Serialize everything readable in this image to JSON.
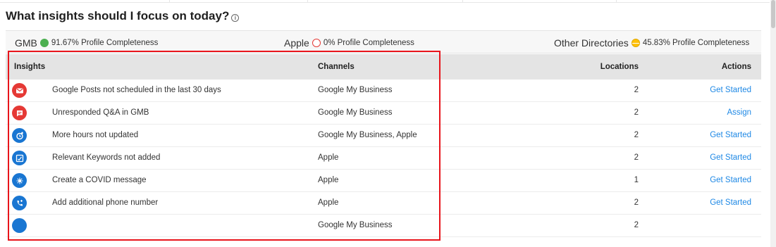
{
  "heading": {
    "title": "What insights should I focus on today?",
    "info_icon": "i"
  },
  "completeness": [
    {
      "name": "GMB",
      "status_color": "#4caf50",
      "text": "91.67% Profile Completeness"
    },
    {
      "name": "Apple",
      "status_color": "#e53935",
      "text": "0% Profile Completeness"
    },
    {
      "name": "Other Directories",
      "status_color": "#ffc107",
      "text": "45.83% Profile Completeness"
    }
  ],
  "table": {
    "headers": {
      "insights": "Insights",
      "channels": "Channels",
      "locations": "Locations",
      "actions": "Actions"
    },
    "rows": [
      {
        "icon": "mail-icon",
        "icon_color": "#e53935",
        "insight": "Google Posts not scheduled in the last 30 days",
        "channels": "Google My Business",
        "locations": "2",
        "action": "Get Started"
      },
      {
        "icon": "chat-icon",
        "icon_color": "#e53935",
        "insight": "Unresponded Q&A in GMB",
        "channels": "Google My Business",
        "locations": "2",
        "action": "Assign"
      },
      {
        "icon": "clock-add-icon",
        "icon_color": "#1976d2",
        "insight": "More hours not updated",
        "channels": "Google My Business, Apple",
        "locations": "2",
        "action": "Get Started"
      },
      {
        "icon": "keyword-icon",
        "icon_color": "#1976d2",
        "insight": "Relevant Keywords not added",
        "channels": "Apple",
        "locations": "2",
        "action": "Get Started"
      },
      {
        "icon": "virus-icon",
        "icon_color": "#1976d2",
        "insight": "Create a COVID message",
        "channels": "Apple",
        "locations": "1",
        "action": "Get Started"
      },
      {
        "icon": "phone-add-icon",
        "icon_color": "#1976d2",
        "insight": "Add additional phone number",
        "channels": "Apple",
        "locations": "2",
        "action": "Get Started"
      },
      {
        "icon": "blank-icon",
        "icon_color": "#1976d2",
        "insight": "",
        "channels": "Google My Business",
        "locations": "2",
        "action": ""
      }
    ]
  },
  "colors": {
    "link": "#1e88e5",
    "highlight_border": "#e8141b",
    "header_bg": "#e4e4e4"
  }
}
